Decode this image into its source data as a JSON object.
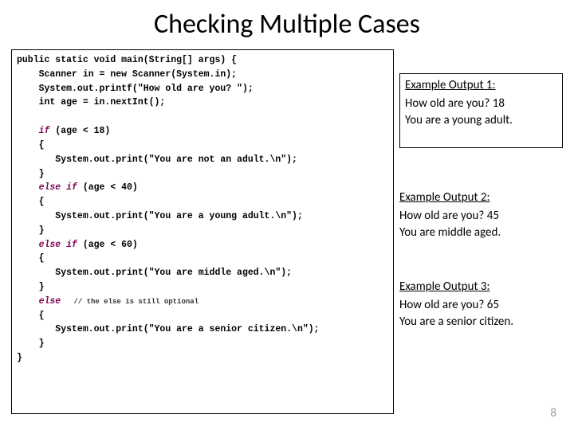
{
  "title": "Checking Multiple Cases",
  "code": {
    "l1a": "public static void main(String[] args) {",
    "l2a": "    Scanner in = new Scanner(System.in);",
    "l3a": "    System.out.printf(\"How old are you? \");",
    "l4a": "    int age = in.nextInt();",
    "blank1": "",
    "l5kw": "    if",
    "l5b": " (age < 18)",
    "l6": "    {",
    "l7": "       System.out.print(\"You are not an adult.\\n\");",
    "l8": "    }",
    "l9kw": "    else if",
    "l9b": " (age < 40)",
    "l10": "    {",
    "l11": "       System.out.print(\"You are a young adult.\\n\");",
    "l12": "    }",
    "l13kw": "    else if",
    "l13b": " (age < 60)",
    "l14": "    {",
    "l15": "       System.out.print(\"You are middle aged.\\n\");",
    "l16": "    }",
    "l17kw": "    else",
    "l17c": "   // the else is still optional",
    "l18": "    {",
    "l19": "       System.out.print(\"You are a senior citizen.\\n\");",
    "l20": "    }",
    "l21": "}"
  },
  "examples": {
    "e1": {
      "label": "Example Output 1:",
      "line1": "How old are you? 18",
      "line2": "You are a young adult."
    },
    "e2": {
      "label": "Example Output 2:",
      "line1": "How old are you? 45",
      "line2": "You are middle aged."
    },
    "e3": {
      "label": "Example Output 3:",
      "line1": "How old are you? 65",
      "line2": "You are a senior citizen."
    }
  },
  "page_number": "8"
}
